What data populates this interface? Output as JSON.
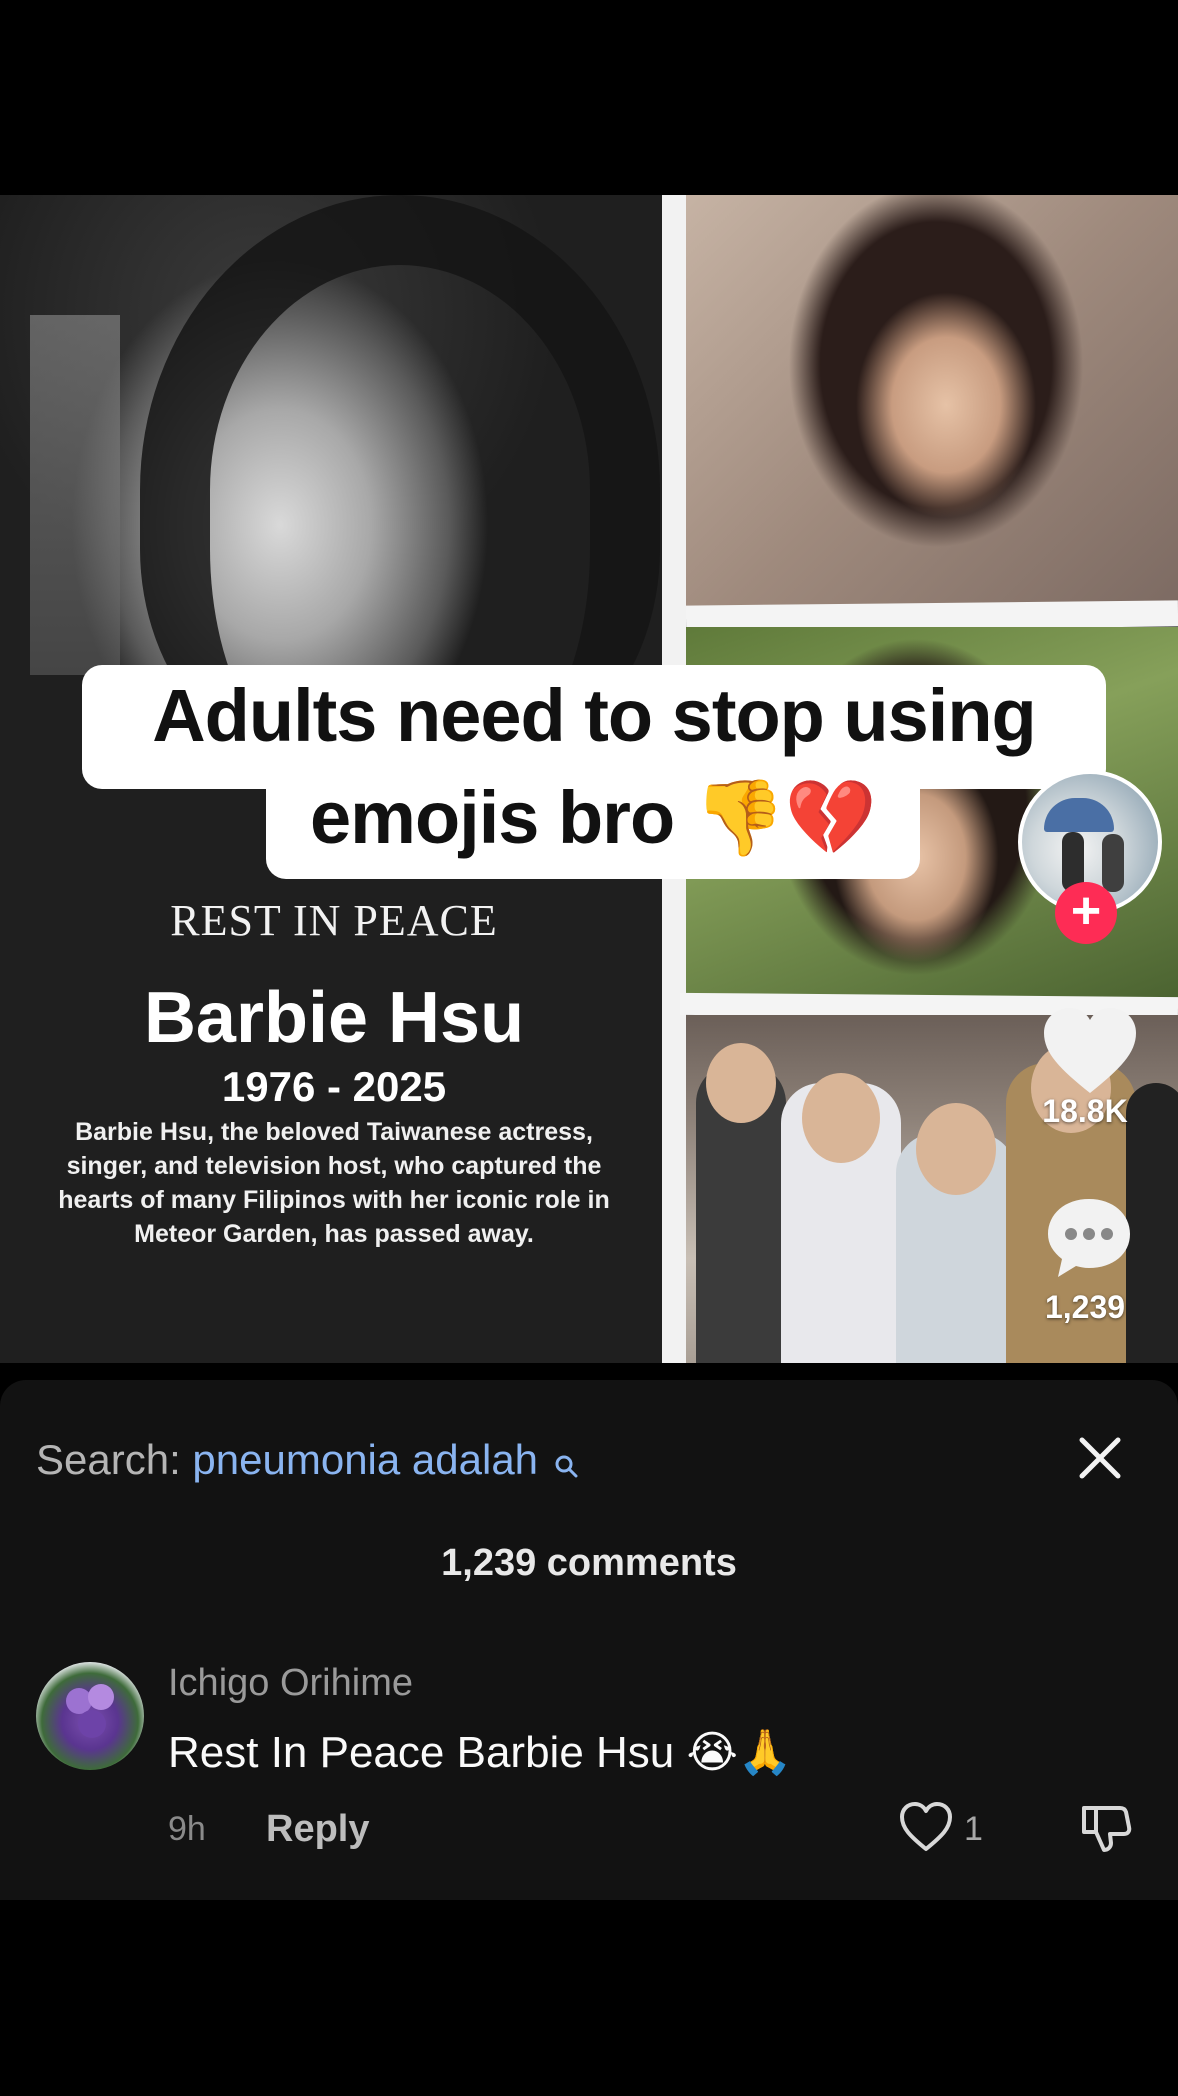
{
  "video": {
    "caption_line1": "Adults need to stop using",
    "caption_line2": "emojis bro 👎💔",
    "rip_label": "REST IN PEACE",
    "rip_name": "Barbie Hsu",
    "rip_years": "1976 - 2025",
    "rip_description": "Barbie Hsu, the beloved Taiwanese actress, singer, and television host, who captured the hearts of many Filipinos with her iconic role in Meteor Garden, has passed away."
  },
  "actions": {
    "follow_label": "+",
    "like_count": "18.8K",
    "comment_count": "1,239"
  },
  "comments_sheet": {
    "search_label": "Search:",
    "search_query": "pneumonia adalah",
    "comments_title": "1,239 comments",
    "comments": [
      {
        "username": "Ichigo Orihime",
        "text": "Rest In Peace Barbie Hsu 😭🙏",
        "time": "9h",
        "reply_label": "Reply",
        "like_count": "1"
      }
    ]
  },
  "colors": {
    "accent_follow": "#fe2c55",
    "search_query": "#8ab4f0",
    "sheet_bg": "#121212"
  },
  "icons": {
    "like": "heart-icon",
    "comment": "comment-bubble-icon",
    "close": "close-icon",
    "search": "search-icon",
    "dislike": "thumbs-down-icon"
  }
}
